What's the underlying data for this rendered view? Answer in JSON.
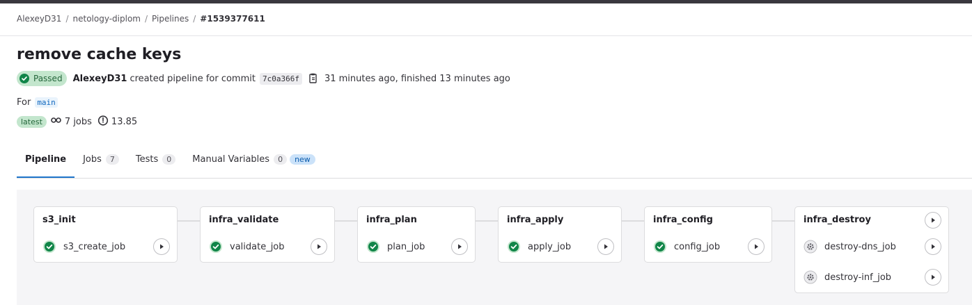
{
  "breadcrumb": {
    "items": [
      "AlexeyD31",
      "netology-diplom",
      "Pipelines"
    ],
    "current": "#1539377611"
  },
  "pipeline": {
    "title": "remove cache keys",
    "status": "Passed",
    "author": "AlexeyD31",
    "created_text": "created pipeline for commit",
    "commit_sha": "7c0a366f",
    "timing": "31 minutes ago, finished 13 minutes ago",
    "for_label": "For",
    "branch": "main",
    "latest_badge": "latest",
    "jobs_count": "7 jobs",
    "duration": "13.85"
  },
  "tabs": [
    {
      "label": "Pipeline"
    },
    {
      "label": "Jobs",
      "count": "7"
    },
    {
      "label": "Tests",
      "count": "0"
    },
    {
      "label": "Manual Variables",
      "count": "0",
      "badge": "new"
    }
  ],
  "stages": [
    {
      "name": "s3_init",
      "jobs": [
        {
          "name": "s3_create_job",
          "status": "success"
        }
      ]
    },
    {
      "name": "infra_validate",
      "jobs": [
        {
          "name": "validate_job",
          "status": "success"
        }
      ]
    },
    {
      "name": "infra_plan",
      "jobs": [
        {
          "name": "plan_job",
          "status": "success"
        }
      ]
    },
    {
      "name": "infra_apply",
      "jobs": [
        {
          "name": "apply_job",
          "status": "success"
        }
      ]
    },
    {
      "name": "infra_config",
      "jobs": [
        {
          "name": "config_job",
          "status": "success"
        }
      ]
    },
    {
      "name": "infra_destroy",
      "jobs": [
        {
          "name": "destroy-dns_job",
          "status": "manual"
        },
        {
          "name": "destroy-inf_job",
          "status": "manual"
        }
      ]
    }
  ],
  "colors": {
    "success": "#108548",
    "success_bg": "#c3e6cd",
    "accent": "#1f75cb",
    "manual": "#626168"
  }
}
